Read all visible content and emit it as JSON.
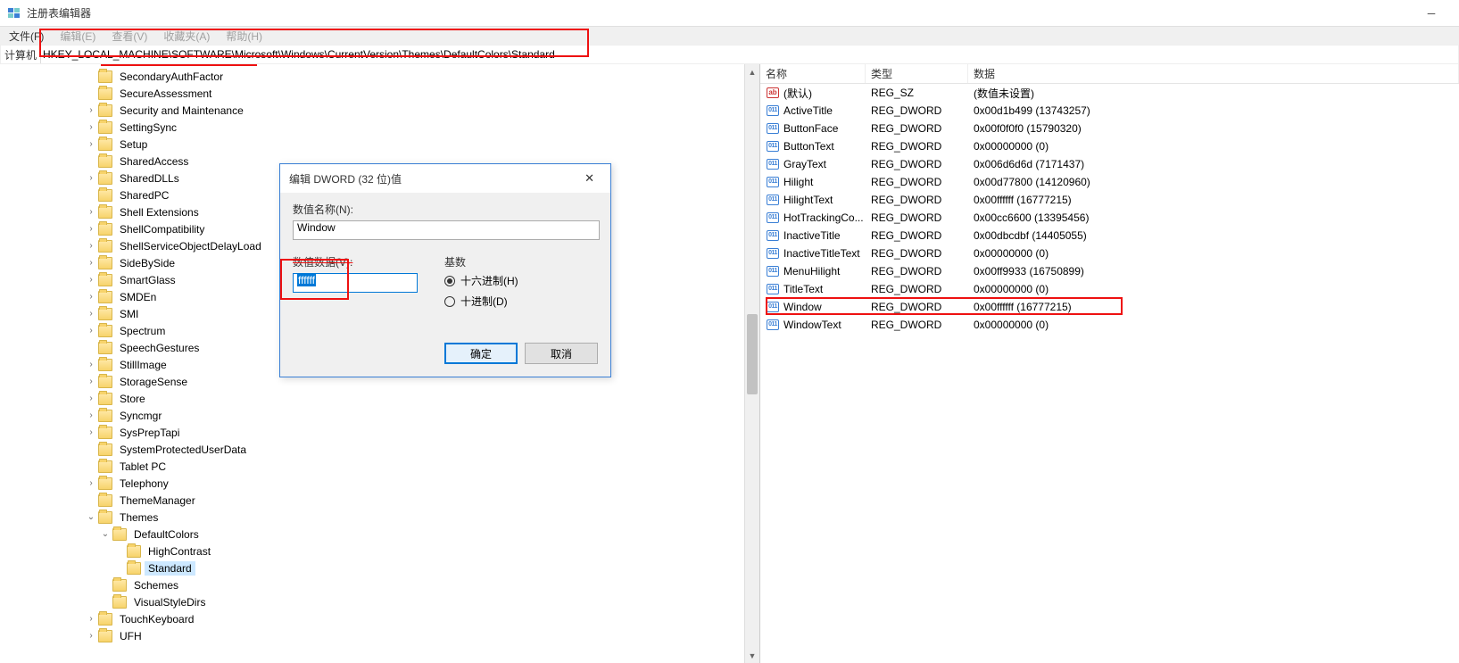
{
  "window": {
    "title": "注册表编辑器"
  },
  "menu": {
    "file": "文件(F)",
    "edit": "编辑(E)",
    "view": "查看(V)",
    "favorites": "收藏夹(A)",
    "help": "帮助(H)"
  },
  "address": {
    "label": "计算机",
    "path": "HKEY_LOCAL_MACHINE\\SOFTWARE\\Microsoft\\Windows\\CurrentVersion\\Themes\\DefaultColors\\Standard"
  },
  "tree": [
    {
      "indent": 6,
      "exp": "",
      "label": "SecondaryAuthFactor",
      "strike": true
    },
    {
      "indent": 6,
      "exp": "",
      "label": "SecureAssessment"
    },
    {
      "indent": 6,
      "exp": ">",
      "label": "Security and Maintenance"
    },
    {
      "indent": 6,
      "exp": ">",
      "label": "SettingSync"
    },
    {
      "indent": 6,
      "exp": ">",
      "label": "Setup"
    },
    {
      "indent": 6,
      "exp": "",
      "label": "SharedAccess"
    },
    {
      "indent": 6,
      "exp": ">",
      "label": "SharedDLLs"
    },
    {
      "indent": 6,
      "exp": "",
      "label": "SharedPC"
    },
    {
      "indent": 6,
      "exp": ">",
      "label": "Shell Extensions"
    },
    {
      "indent": 6,
      "exp": ">",
      "label": "ShellCompatibility"
    },
    {
      "indent": 6,
      "exp": ">",
      "label": "ShellServiceObjectDelayLoad"
    },
    {
      "indent": 6,
      "exp": ">",
      "label": "SideBySide"
    },
    {
      "indent": 6,
      "exp": ">",
      "label": "SmartGlass"
    },
    {
      "indent": 6,
      "exp": ">",
      "label": "SMDEn"
    },
    {
      "indent": 6,
      "exp": ">",
      "label": "SMI"
    },
    {
      "indent": 6,
      "exp": ">",
      "label": "Spectrum"
    },
    {
      "indent": 6,
      "exp": "",
      "label": "SpeechGestures"
    },
    {
      "indent": 6,
      "exp": ">",
      "label": "StillImage"
    },
    {
      "indent": 6,
      "exp": ">",
      "label": "StorageSense"
    },
    {
      "indent": 6,
      "exp": ">",
      "label": "Store"
    },
    {
      "indent": 6,
      "exp": ">",
      "label": "Syncmgr"
    },
    {
      "indent": 6,
      "exp": ">",
      "label": "SysPrepTapi"
    },
    {
      "indent": 6,
      "exp": "",
      "label": "SystemProtectedUserData"
    },
    {
      "indent": 6,
      "exp": "",
      "label": "Tablet PC"
    },
    {
      "indent": 6,
      "exp": ">",
      "label": "Telephony"
    },
    {
      "indent": 6,
      "exp": "",
      "label": "ThemeManager"
    },
    {
      "indent": 6,
      "exp": "v",
      "label": "Themes"
    },
    {
      "indent": 7,
      "exp": "v",
      "label": "DefaultColors"
    },
    {
      "indent": 8,
      "exp": "",
      "label": "HighContrast"
    },
    {
      "indent": 8,
      "exp": "",
      "label": "Standard",
      "selected": true
    },
    {
      "indent": 7,
      "exp": "",
      "label": "Schemes"
    },
    {
      "indent": 7,
      "exp": "",
      "label": "VisualStyleDirs"
    },
    {
      "indent": 6,
      "exp": ">",
      "label": "TouchKeyboard"
    },
    {
      "indent": 6,
      "exp": ">",
      "label": "UFH"
    }
  ],
  "list": {
    "cols": {
      "name": "名称",
      "type": "类型",
      "data": "数据"
    },
    "rows": [
      {
        "icon": "ab",
        "name": "(默认)",
        "type": "REG_SZ",
        "data": "(数值未设置)"
      },
      {
        "icon": "bin",
        "name": "ActiveTitle",
        "type": "REG_DWORD",
        "data": "0x00d1b499 (13743257)"
      },
      {
        "icon": "bin",
        "name": "ButtonFace",
        "type": "REG_DWORD",
        "data": "0x00f0f0f0 (15790320)"
      },
      {
        "icon": "bin",
        "name": "ButtonText",
        "type": "REG_DWORD",
        "data": "0x00000000 (0)"
      },
      {
        "icon": "bin",
        "name": "GrayText",
        "type": "REG_DWORD",
        "data": "0x006d6d6d (7171437)"
      },
      {
        "icon": "bin",
        "name": "Hilight",
        "type": "REG_DWORD",
        "data": "0x00d77800 (14120960)"
      },
      {
        "icon": "bin",
        "name": "HilightText",
        "type": "REG_DWORD",
        "data": "0x00ffffff (16777215)"
      },
      {
        "icon": "bin",
        "name": "HotTrackingCo...",
        "type": "REG_DWORD",
        "data": "0x00cc6600 (13395456)"
      },
      {
        "icon": "bin",
        "name": "InactiveTitle",
        "type": "REG_DWORD",
        "data": "0x00dbcdbf (14405055)"
      },
      {
        "icon": "bin",
        "name": "InactiveTitleText",
        "type": "REG_DWORD",
        "data": "0x00000000 (0)"
      },
      {
        "icon": "bin",
        "name": "MenuHilight",
        "type": "REG_DWORD",
        "data": "0x00ff9933 (16750899)"
      },
      {
        "icon": "bin",
        "name": "TitleText",
        "type": "REG_DWORD",
        "data": "0x00000000 (0)"
      },
      {
        "icon": "bin",
        "name": "Window",
        "type": "REG_DWORD",
        "data": "0x00ffffff (16777215)",
        "hl": true
      },
      {
        "icon": "bin",
        "name": "WindowText",
        "type": "REG_DWORD",
        "data": "0x00000000 (0)"
      }
    ]
  },
  "dialog": {
    "title": "编辑 DWORD (32 位)值",
    "name_label": "数值名称(N):",
    "name_value": "Window",
    "data_label": "数值数据(V):",
    "data_value": "ffffff",
    "base_label": "基数",
    "hex": "十六进制(H)",
    "dec": "十进制(D)",
    "ok": "确定",
    "cancel": "取消"
  }
}
